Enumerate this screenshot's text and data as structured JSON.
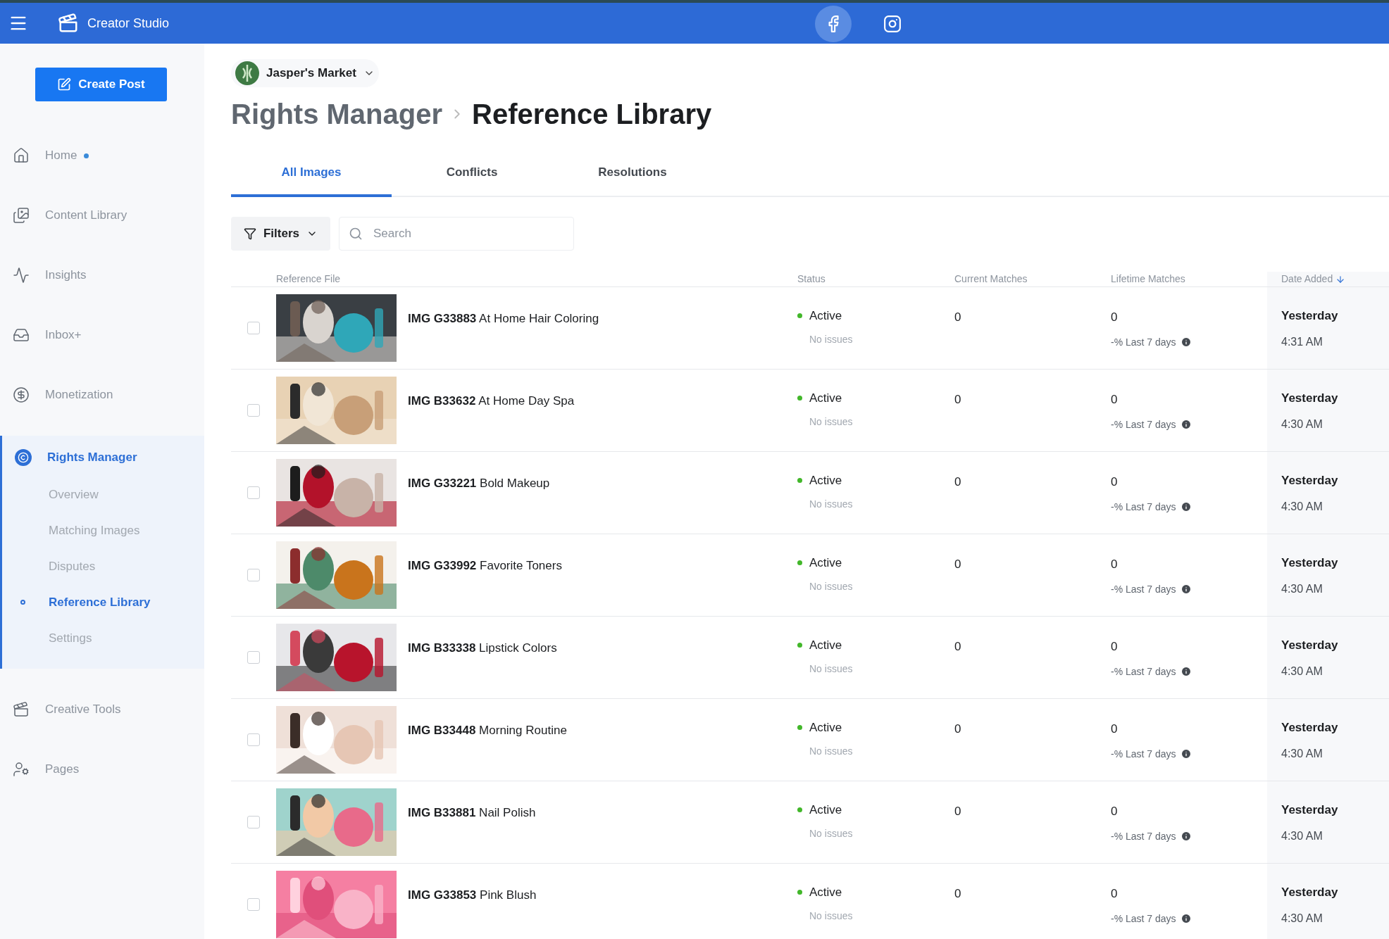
{
  "topbar": {
    "title": "Creator Studio",
    "platforms": [
      {
        "kind": "facebook",
        "selected": true
      },
      {
        "kind": "instagram",
        "selected": false
      }
    ]
  },
  "create_button": "Create Post",
  "sidebar": {
    "items": [
      {
        "label": "Home",
        "dot": true,
        "selected": false
      },
      {
        "label": "Content Library",
        "selected": false
      },
      {
        "label": "Insights",
        "selected": false
      },
      {
        "label": "Inbox+",
        "selected": false
      },
      {
        "label": "Monetization",
        "selected": false
      },
      {
        "label": "Rights Manager",
        "selected": true,
        "expanded": true,
        "children": [
          {
            "label": "Overview",
            "selected": false
          },
          {
            "label": "Matching Images",
            "selected": false
          },
          {
            "label": "Disputes",
            "selected": false
          },
          {
            "label": "Reference Library",
            "selected": true
          },
          {
            "label": "Settings",
            "selected": false
          }
        ]
      },
      {
        "label": "Creative Tools",
        "selected": false
      },
      {
        "label": "Pages",
        "selected": false
      }
    ]
  },
  "account": "Jasper's Market",
  "breadcrumb": [
    "Rights Manager",
    "Reference Library"
  ],
  "tabs": [
    {
      "label": "All Images",
      "selected": true
    },
    {
      "label": "Conflicts",
      "selected": false
    },
    {
      "label": "Resolutions",
      "selected": false
    }
  ],
  "filters": "Filters",
  "search": {
    "placeholder": "Search"
  },
  "table": {
    "columns": [
      {
        "label": "Reference File",
        "sorted": false
      },
      {
        "label": "Status",
        "sorted": false
      },
      {
        "label": "Current Matches",
        "sorted": false
      },
      {
        "label": "Lifetime Matches",
        "sorted": false
      },
      {
        "label": "Date Added",
        "sorted": true
      }
    ],
    "rows": [
      {
        "checked": false,
        "name": "**IMG G33883** At Home Hair Coloring",
        "status": "Active",
        "status_note": "No issues",
        "current": "0",
        "lifetime": "0",
        "lifetime_note": "-% Last 7 days",
        "date": "Yesterday",
        "time": "4:31 AM"
      },
      {
        "checked": false,
        "name": "**IMG B33632** At Home Day Spa",
        "status": "Active",
        "status_note": "No issues",
        "current": "0",
        "lifetime": "0",
        "lifetime_note": "-% Last 7 days",
        "date": "Yesterday",
        "time": "4:30 AM"
      },
      {
        "checked": false,
        "name": "**IMG G33221** Bold Makeup",
        "status": "Active",
        "status_note": "No issues",
        "current": "0",
        "lifetime": "0",
        "lifetime_note": "-% Last 7 days",
        "date": "Yesterday",
        "time": "4:30 AM"
      },
      {
        "checked": false,
        "name": "**IMG G33992** Favorite Toners",
        "status": "Active",
        "status_note": "No issues",
        "current": "0",
        "lifetime": "0",
        "lifetime_note": "-% Last 7 days",
        "date": "Yesterday",
        "time": "4:30 AM"
      },
      {
        "checked": false,
        "name": "**IMG B33338** Lipstick Colors",
        "status": "Active",
        "status_note": "No issues",
        "current": "0",
        "lifetime": "0",
        "lifetime_note": "-% Last 7 days",
        "date": "Yesterday",
        "time": "4:30 AM"
      },
      {
        "checked": false,
        "name": "**IMG B33448** Morning Routine",
        "status": "Active",
        "status_note": "No issues",
        "current": "0",
        "lifetime": "0",
        "lifetime_note": "-% Last 7 days",
        "date": "Yesterday",
        "time": "4:30 AM"
      },
      {
        "checked": false,
        "name": "**IMG B33881** Nail Polish",
        "status": "Active",
        "status_note": "No issues",
        "current": "0",
        "lifetime": "0",
        "lifetime_note": "-% Last 7 days",
        "date": "Yesterday",
        "time": "4:30 AM"
      },
      {
        "checked": false,
        "name": "**IMG G33853** Pink Blush",
        "status": "Active",
        "status_note": "No issues",
        "current": "0",
        "lifetime": "0",
        "lifetime_note": "-% Last 7 days",
        "date": "Yesterday",
        "time": "4:30 AM"
      }
    ]
  }
}
